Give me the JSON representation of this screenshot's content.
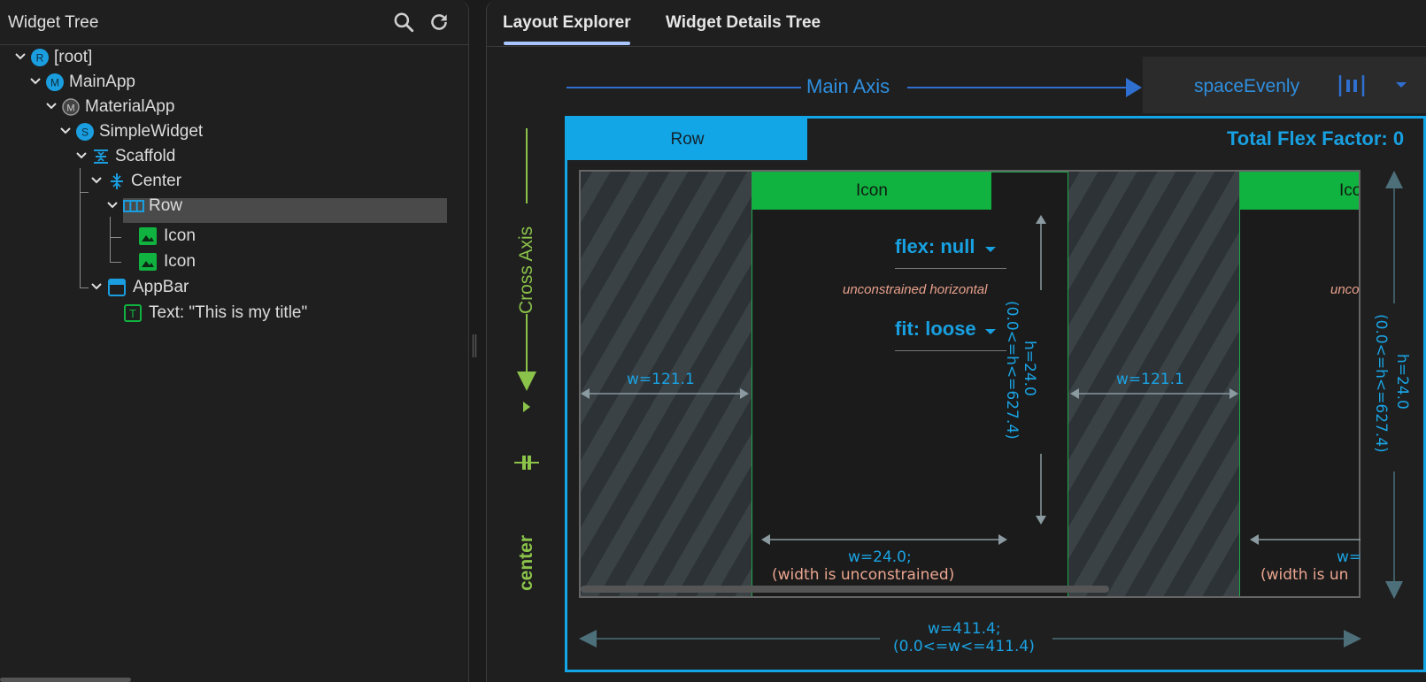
{
  "left_panel": {
    "title": "Widget Tree",
    "search_icon": "search-icon",
    "refresh_icon": "refresh-icon",
    "tree": [
      {
        "label": "[root]",
        "badge": "R"
      },
      {
        "label": "MainApp",
        "badge": "M"
      },
      {
        "label": "MaterialApp",
        "badge": "M"
      },
      {
        "label": "SimpleWidget",
        "badge": "S"
      },
      {
        "label": "Scaffold",
        "badge": ""
      },
      {
        "label": "Center",
        "badge": ""
      },
      {
        "label": "Row",
        "badge": "",
        "selected": true
      },
      {
        "label": "Icon",
        "badge": ""
      },
      {
        "label": "Icon",
        "badge": ""
      },
      {
        "label": "AppBar",
        "badge": ""
      },
      {
        "label": "Text: \"This is my title\"",
        "badge": "T"
      }
    ]
  },
  "tabs": [
    {
      "label": "Layout Explorer",
      "active": true
    },
    {
      "label": "Widget Details Tree",
      "active": false
    }
  ],
  "layout": {
    "main_axis_label": "Main Axis",
    "main_axis_alignment": "spaceEvenly",
    "cross_axis_label": "Cross Axis",
    "cross_axis_alignment": "center",
    "row_label": "Row",
    "total_flex": "Total Flex Factor: 0",
    "children": [
      {
        "label": "Icon",
        "flex": "flex: null",
        "unconstrained": "unconstrained horizontal",
        "fit": "fit: loose",
        "height_main": "h=24.0",
        "height_range": "(0.0<=h<=627.4)",
        "width_main": "w=24.0;",
        "width_note": "(width is unconstrained)"
      },
      {
        "label": "Icon",
        "unconstrained": "unco",
        "width_main": "w=",
        "width_note": "(width is un"
      }
    ],
    "space_width": "w=121.1",
    "space_width_2": "w=121.1",
    "outer_height_main": "h=24.0",
    "outer_height_range": "(0.0<=h<=627.4)",
    "outer_width_main": "w=411.4;",
    "outer_width_range": "(0.0<=w<=411.4)"
  },
  "colors": {
    "accent": "#12a6e6",
    "child": "#11b340",
    "cross_axis": "#8bc34a",
    "main_axis": "#2f6fd0",
    "note": "#eaa58f"
  }
}
